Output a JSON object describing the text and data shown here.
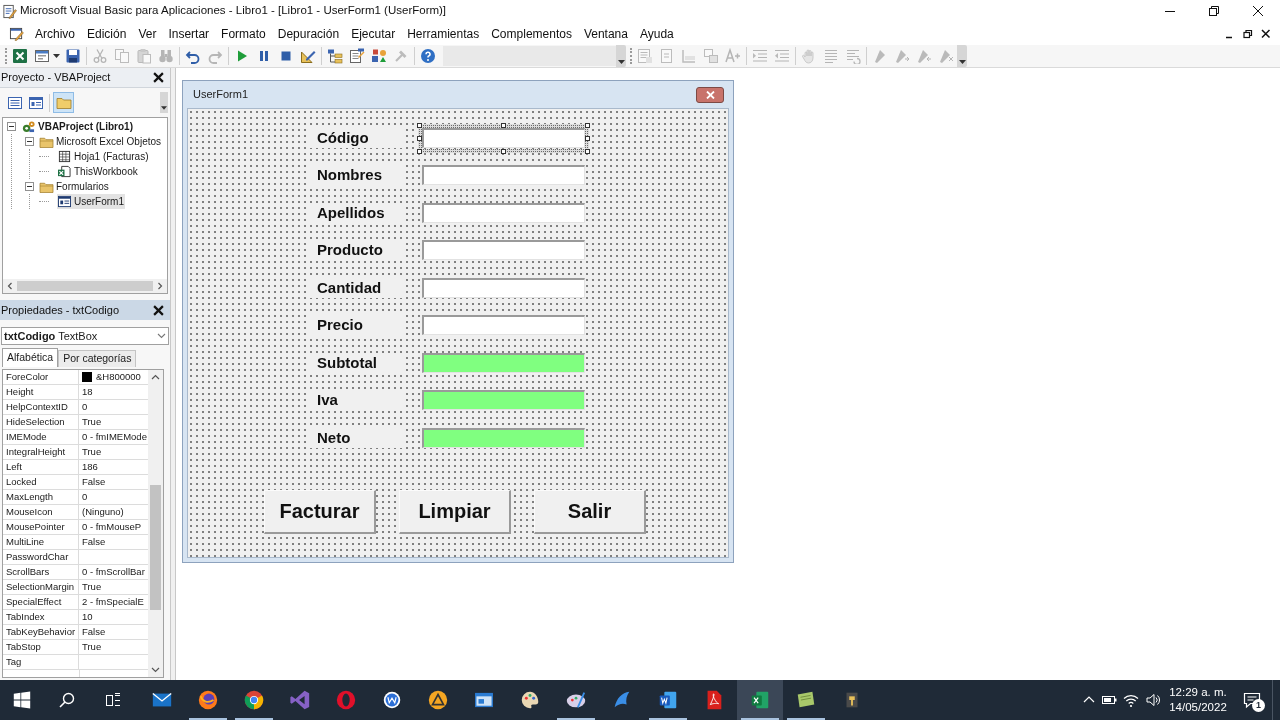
{
  "window": {
    "title": "Microsoft Visual Basic para Aplicaciones - Libro1 - [Libro1 - UserForm1 (UserForm)]"
  },
  "menu": [
    "Archivo",
    "Edición",
    "Ver",
    "Insertar",
    "Formato",
    "Depuración",
    "Ejecutar",
    "Herramientas",
    "Complementos",
    "Ventana",
    "Ayuda"
  ],
  "toolbars": [
    {
      "groups": [
        [
          {
            "kind": "excel",
            "disabled": false
          },
          {
            "kind": "view-form",
            "disabled": false
          },
          {
            "kind": "save",
            "disabled": false
          }
        ],
        [
          {
            "kind": "cut",
            "disabled": true
          },
          {
            "kind": "copy",
            "disabled": true
          },
          {
            "kind": "paste",
            "disabled": true
          },
          {
            "kind": "find",
            "disabled": true
          }
        ],
        [
          {
            "kind": "undo",
            "disabled": false
          },
          {
            "kind": "redo",
            "disabled": true
          }
        ],
        [
          {
            "kind": "run",
            "disabled": false
          },
          {
            "kind": "pause",
            "disabled": false
          },
          {
            "kind": "stop",
            "disabled": false
          },
          {
            "kind": "design",
            "disabled": false
          }
        ],
        [
          {
            "kind": "explorer",
            "disabled": false
          },
          {
            "kind": "properties",
            "disabled": false
          },
          {
            "kind": "browser",
            "disabled": false
          },
          {
            "kind": "toolbox",
            "disabled": true
          }
        ],
        [
          {
            "kind": "help",
            "disabled": false
          }
        ]
      ]
    },
    {
      "groups": [
        [
          {
            "kind": "list-members",
            "disabled": true
          },
          {
            "kind": "list-constants",
            "disabled": true
          },
          {
            "kind": "quick-info",
            "disabled": true
          },
          {
            "kind": "param-info",
            "disabled": true
          },
          {
            "kind": "complete-word",
            "disabled": true
          }
        ],
        [
          {
            "kind": "indent",
            "disabled": true
          },
          {
            "kind": "outdent",
            "disabled": true
          }
        ],
        [
          {
            "kind": "breakpoint",
            "disabled": true
          },
          {
            "kind": "comment",
            "disabled": true
          },
          {
            "kind": "uncomment",
            "disabled": true
          }
        ],
        [
          {
            "kind": "bookmark",
            "disabled": true
          },
          {
            "kind": "next-bookmark",
            "disabled": true
          },
          {
            "kind": "prev-bookmark",
            "disabled": true
          },
          {
            "kind": "clear-bookmarks",
            "disabled": true
          }
        ]
      ]
    }
  ],
  "project": {
    "title": "Proyecto - VBAProject",
    "toolbar": [
      {
        "kind": "view-code",
        "on": false
      },
      {
        "kind": "view-object",
        "on": false
      },
      {
        "kind": "toggle-folders",
        "on": true
      }
    ],
    "tree": [
      {
        "label": "VBAProject (Libro1)",
        "kind": "project",
        "expanded": true,
        "selected": false,
        "children": [
          {
            "label": "Microsoft Excel Objetos",
            "kind": "folder",
            "expanded": true,
            "selected": false,
            "children": [
              {
                "label": "Hoja1 (Facturas)",
                "kind": "sheet",
                "selected": false
              },
              {
                "label": "ThisWorkbook",
                "kind": "workbook",
                "selected": false
              }
            ]
          },
          {
            "label": "Formularios",
            "kind": "folder",
            "expanded": true,
            "selected": false,
            "children": [
              {
                "label": "UserForm1",
                "kind": "form",
                "selected": true
              }
            ]
          }
        ]
      }
    ]
  },
  "properties": {
    "title": "Propiedades - txtCodigo",
    "object": "**txtCodigo** TextBox",
    "tabs": [
      {
        "label": "Alfabética",
        "selected": true
      },
      {
        "label": "Por categorías",
        "selected": false
      }
    ],
    "rows": [
      {
        "name": "ForeColor",
        "value": "&H800000",
        "color": "#000000"
      },
      {
        "name": "Height",
        "value": "18"
      },
      {
        "name": "HelpContextID",
        "value": "0"
      },
      {
        "name": "HideSelection",
        "value": "True"
      },
      {
        "name": "IMEMode",
        "value": "0 - fmIMEMode"
      },
      {
        "name": "IntegralHeight",
        "value": "True"
      },
      {
        "name": "Left",
        "value": "186"
      },
      {
        "name": "Locked",
        "value": "False"
      },
      {
        "name": "MaxLength",
        "value": "0"
      },
      {
        "name": "MouseIcon",
        "value": "(Ninguno)"
      },
      {
        "name": "MousePointer",
        "value": "0 - fmMouseP"
      },
      {
        "name": "MultiLine",
        "value": "False"
      },
      {
        "name": "PasswordChar"
      },
      {
        "name": "ScrollBars",
        "value": "0 - fmScrollBar"
      },
      {
        "name": "SelectionMargin",
        "value": "True"
      },
      {
        "name": "SpecialEffect",
        "value": "2 - fmSpecialE"
      },
      {
        "name": "TabIndex",
        "value": "10"
      },
      {
        "name": "TabKeyBehavior",
        "value": "False"
      },
      {
        "name": "TabStop",
        "value": "True"
      },
      {
        "name": "Tag"
      }
    ]
  },
  "form": {
    "title": "UserForm1",
    "fields": [
      {
        "label": "Código",
        "color": "#ffffff",
        "selected": true
      },
      {
        "label": "Nombres",
        "color": "#ffffff",
        "selected": false
      },
      {
        "label": "Apellidos",
        "color": "#ffffff",
        "selected": false
      },
      {
        "label": "Producto",
        "color": "#ffffff",
        "selected": false
      },
      {
        "label": "Cantidad",
        "color": "#ffffff",
        "selected": false
      },
      {
        "label": "Precio",
        "color": "#ffffff",
        "selected": false
      },
      {
        "label": "Subtotal",
        "color": "#80ff80",
        "selected": false
      },
      {
        "label": "Iva",
        "color": "#80ff80",
        "selected": false
      },
      {
        "label": "Neto",
        "color": "#80ff80",
        "selected": false
      }
    ],
    "buttons": [
      "Facturar",
      "Limpiar",
      "Salir"
    ]
  },
  "taskbar": {
    "apps": [
      {
        "kind": "mail",
        "running": false,
        "active": false
      },
      {
        "kind": "firefox",
        "running": true,
        "active": false
      },
      {
        "kind": "chrome",
        "running": true,
        "active": false
      },
      {
        "kind": "vs",
        "running": false,
        "active": false
      },
      {
        "kind": "opera",
        "running": false,
        "active": false
      },
      {
        "kind": "w-circle",
        "running": false,
        "active": false
      },
      {
        "kind": "triangle",
        "running": false,
        "active": false
      },
      {
        "kind": "window",
        "running": false,
        "active": false
      },
      {
        "kind": "palette",
        "running": false,
        "active": false
      },
      {
        "kind": "palette2",
        "running": true,
        "active": false
      },
      {
        "kind": "wing",
        "running": false,
        "active": false
      },
      {
        "kind": "word",
        "running": true,
        "active": false
      },
      {
        "kind": "acrobat",
        "running": false,
        "active": false
      },
      {
        "kind": "excel",
        "running": true,
        "active": true
      },
      {
        "kind": "notebook",
        "running": true,
        "active": false
      },
      {
        "kind": "tool",
        "running": false,
        "active": false
      }
    ],
    "time": "12:29 a. m.",
    "date": "14/05/2022",
    "notifications": "1"
  }
}
